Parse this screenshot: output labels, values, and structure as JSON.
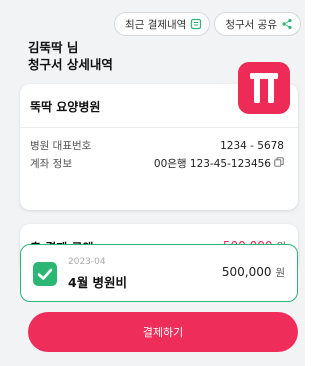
{
  "top_actions": {
    "history_label": "최근 결제내역",
    "share_label": "청구서 공유"
  },
  "header": {
    "user_name": "김뚝딱 님",
    "doc_title": "청구서 상세내역"
  },
  "hospital": {
    "name": "뚝딱 요양병원",
    "phone_label": "병원 대표번호",
    "phone_value": "1234 - 5678",
    "account_label": "계좌 정보",
    "account_value": "00은행 123-45-123456"
  },
  "total": {
    "label": "총 결제 금액",
    "amount": "500,000",
    "unit": "원"
  },
  "bill": {
    "date": "2023-04",
    "title": "4월 병원비",
    "amount": "500,000",
    "unit": "원",
    "checked": true
  },
  "pay_button": {
    "label": "결제하기"
  },
  "colors": {
    "accent": "#ef2d5a",
    "check": "#2bb673",
    "amount": "#e8285a"
  },
  "icons": {
    "history": "receipt-icon",
    "share": "share-icon",
    "copy": "copy-icon",
    "logo": "app-logo-icon",
    "check": "checkbox-checked-icon"
  }
}
